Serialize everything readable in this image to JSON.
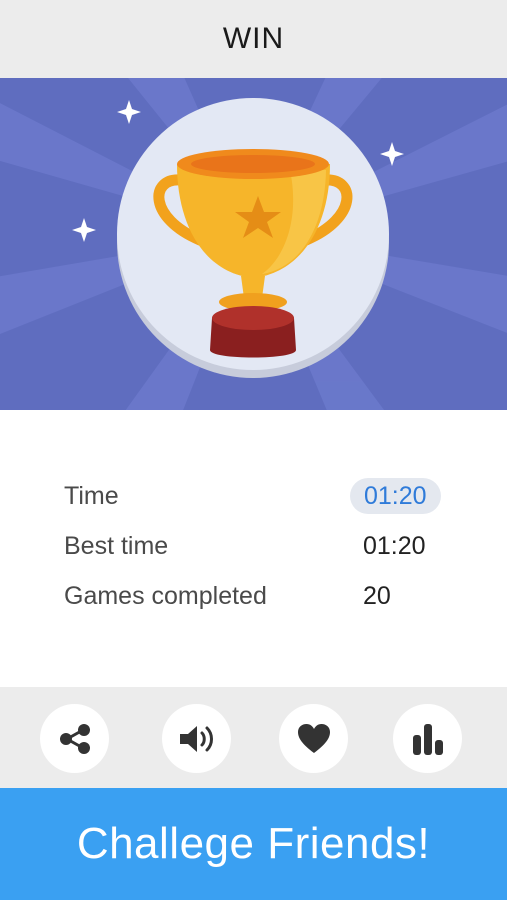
{
  "header": {
    "title": "WIN"
  },
  "hero": {
    "image": "trophy-illustration",
    "background_color": "#5f6dbf"
  },
  "stats": {
    "rows": [
      {
        "label": "Time",
        "value": "01:20"
      },
      {
        "label": "Best time",
        "value": "01:20"
      },
      {
        "label": "Games completed",
        "value": "20"
      }
    ]
  },
  "toolbar": {
    "buttons": [
      {
        "icon": "share-icon"
      },
      {
        "icon": "sound-icon"
      },
      {
        "icon": "heart-icon"
      },
      {
        "icon": "leaderboard-icon"
      }
    ]
  },
  "cta": {
    "label": "Challege Friends!",
    "color": "#3aa0f2"
  }
}
